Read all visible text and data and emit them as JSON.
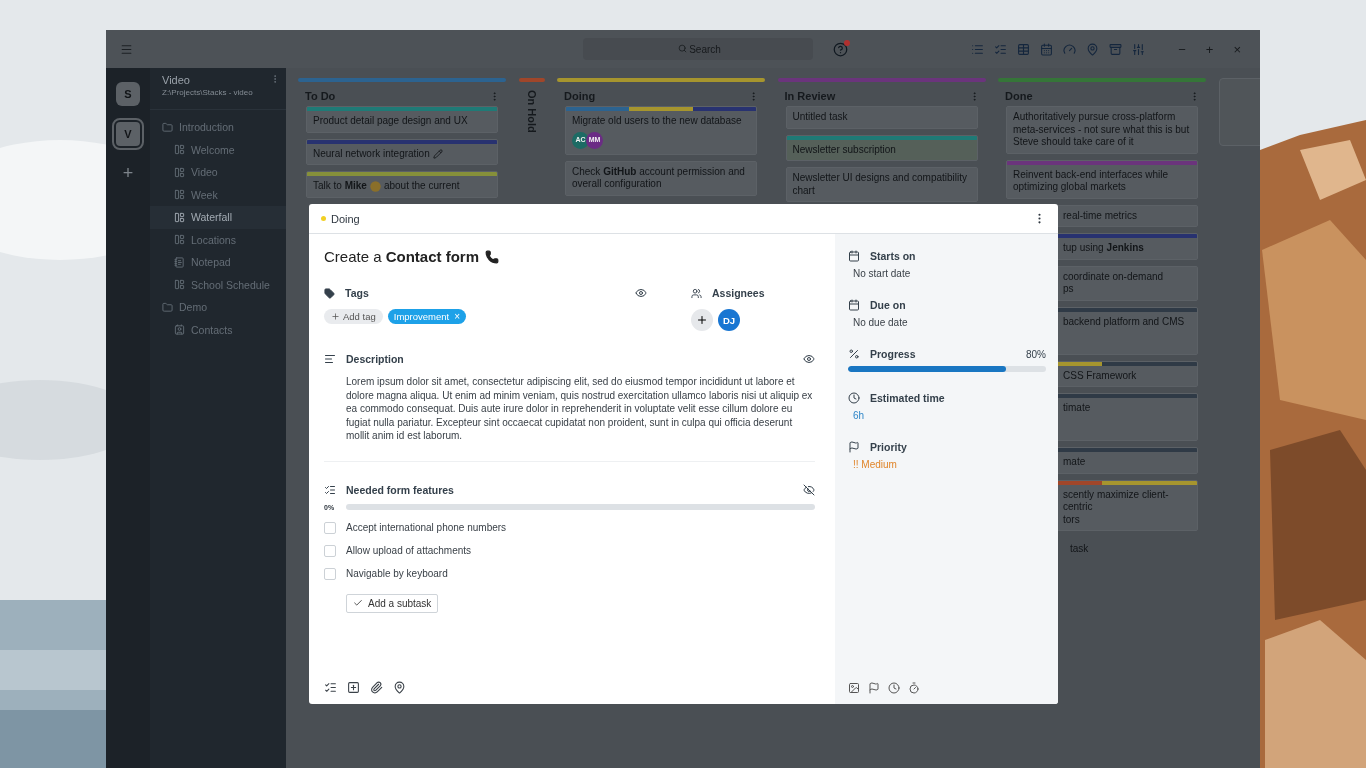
{
  "titlebar": {
    "search_placeholder": "Search",
    "window_controls": [
      "−",
      "+",
      "×"
    ]
  },
  "rail": {
    "workspaces": [
      {
        "label": "S",
        "selected": false
      },
      {
        "label": "V",
        "selected": true
      }
    ],
    "add": "+"
  },
  "project": {
    "name": "Video",
    "path": "Z:\\Projects\\Stacks - video"
  },
  "tree": [
    {
      "label": "Introduction",
      "kind": "folder",
      "selected": false,
      "children": [
        {
          "label": "Welcome",
          "kind": "board",
          "selected": false
        },
        {
          "label": "Video",
          "kind": "board",
          "selected": false
        },
        {
          "label": "Week",
          "kind": "board",
          "selected": false
        },
        {
          "label": "Waterfall",
          "kind": "board",
          "selected": true
        },
        {
          "label": "Locations",
          "kind": "board",
          "selected": false
        },
        {
          "label": "Notepad",
          "kind": "note",
          "selected": false
        },
        {
          "label": "School Schedule",
          "kind": "board",
          "selected": false
        }
      ]
    },
    {
      "label": "Demo",
      "kind": "folder",
      "selected": false,
      "children": [
        {
          "label": "Contacts",
          "kind": "contacts",
          "selected": false
        }
      ]
    }
  ],
  "columns": [
    {
      "title": "To Do",
      "color": "#2c6390",
      "collapsed": false,
      "cards": [
        {
          "kind": "plain",
          "text": "Product detail page design and UX",
          "bars": [
            {
              "color": "#1f7a76"
            }
          ],
          "clipped": false
        },
        {
          "kind": "pencil",
          "text": "Neural network integration",
          "bars": [
            {
              "color": "#283270"
            }
          ],
          "clipped": false
        },
        {
          "kind": "emoji",
          "text": "Talk to **Mike**",
          "text_after": "about the current",
          "bars": [
            {
              "color": "#86903a"
            }
          ],
          "clipped": false
        }
      ]
    },
    {
      "title": "On Hold",
      "color": "#a0462a",
      "collapsed": true
    },
    {
      "title": "Doing",
      "color": "#a6952e",
      "collapsed": false,
      "cards": [
        {
          "kind": "plain",
          "text": "Migrate old users to the new database",
          "bars": [
            {
              "color": "#2c6390"
            },
            {
              "color": "#a6952e"
            },
            {
              "color": "#283270"
            }
          ],
          "clipped": false,
          "avatars": [
            {
              "initials": "AC",
              "color": "#1d6b64"
            },
            {
              "initials": "MM",
              "color": "#6b2c85"
            }
          ]
        },
        {
          "kind": "plain",
          "text": "Check **GitHub** account permission and overall configuration",
          "clipped": false
        }
      ]
    },
    {
      "title": "In Review",
      "color": "#6b347c",
      "collapsed": false,
      "cards": [
        {
          "kind": "plain",
          "text": "Untitled task",
          "clipped": false
        },
        {
          "kind": "plain",
          "text": "Newsletter subscription",
          "bars": [
            {
              "color": "#1f7a76"
            }
          ],
          "clipped": false,
          "highlighted": true
        },
        {
          "kind": "plain",
          "text": "Newsletter UI designs and compatibility chart",
          "clipped": false
        }
      ]
    },
    {
      "title": "Done",
      "color": "#357538",
      "collapsed": false,
      "add_task": "task",
      "cards": [
        {
          "kind": "plain",
          "text": "Authoritatively pursue cross-platform meta-services - not sure what this is but Steve should take care of it",
          "clipped": false
        },
        {
          "kind": "plain",
          "text": "Reinvent back-end interfaces while optimizing global markets",
          "bars": [
            {
              "color": "#6b347c"
            }
          ],
          "clipped": false
        },
        {
          "kind": "plain",
          "text": "real-time metrics",
          "clipped": true
        },
        {
          "kind": "plain",
          "text": "tup using **Jenkins**",
          "bars": [
            {
              "color": "#283270"
            }
          ],
          "clipped": true
        },
        {
          "kind": "plain",
          "text": "coordinate on-demand\nps",
          "clipped": true
        },
        {
          "kind": "plain",
          "text": "backend platform and CMS",
          "bars": [
            {
              "color": "#2f3a46"
            }
          ],
          "clipped": true,
          "tall": true
        },
        {
          "kind": "plain",
          "text": "CSS Framework",
          "bars": [
            {
              "color": "#a6952e"
            },
            {
              "color": "#2f3a46"
            }
          ],
          "clipped": true
        },
        {
          "kind": "plain",
          "text": "timate",
          "bars": [
            {
              "color": "#2f3a46"
            }
          ],
          "clipped": true,
          "tall": true
        },
        {
          "kind": "plain",
          "text": "mate",
          "bars": [
            {
              "color": "#2f3a46"
            }
          ],
          "clipped": true
        },
        {
          "kind": "plain",
          "text": "scently maximize client-centric\ntors",
          "bars": [
            {
              "color": "#a0462a"
            },
            {
              "color": "#a6952e"
            }
          ],
          "clipped": true
        }
      ]
    }
  ],
  "modal": {
    "status": {
      "label": "Doing",
      "color": "#f2d024"
    },
    "title": "Create a **Contact form**",
    "tags": {
      "label": "Tags",
      "visible": true,
      "add": "Add tag",
      "items": [
        {
          "label": "Improvement",
          "color": "#1da1e8",
          "remove": "×"
        }
      ]
    },
    "assignees": {
      "label": "Assignees",
      "people": [
        {
          "initials": "DJ",
          "color": "#1976d2"
        }
      ]
    },
    "description": {
      "label": "Description",
      "visible": true,
      "text": "Lorem ipsum dolor sit amet, consectetur adipiscing elit, sed do eiusmod tempor incididunt ut labore et dolore magna aliqua. Ut enim ad minim veniam, quis nostrud exercitation ullamco laboris nisi ut aliquip ex ea commodo consequat. Duis aute irure dolor in reprehenderit in voluptate velit esse cillum dolore eu fugiat nulla pariatur. Excepteur sint occaecat cupidatat non proident, sunt in culpa qui officia deserunt mollit anim id est laborum."
    },
    "checklist": {
      "label": "Needed form features",
      "visible": false,
      "percent": "0%",
      "level": 0,
      "add": "Add a subtask",
      "items": [
        {
          "label": "Accept international phone numbers",
          "checked": false
        },
        {
          "label": "Allow upload of attachments",
          "checked": false
        },
        {
          "label": "Navigable by keyboard",
          "checked": false
        }
      ]
    },
    "fields": [
      {
        "kind": "date",
        "label": "Starts on",
        "value": "No start date"
      },
      {
        "kind": "date",
        "label": "Due on",
        "value": "No due date"
      },
      {
        "kind": "progress",
        "label": "Progress",
        "value": "80%",
        "level": 0.8
      },
      {
        "kind": "time",
        "label": "Estimated time",
        "value": "6h"
      },
      {
        "kind": "priority",
        "label": "Priority",
        "value": "!! Medium"
      }
    ]
  }
}
